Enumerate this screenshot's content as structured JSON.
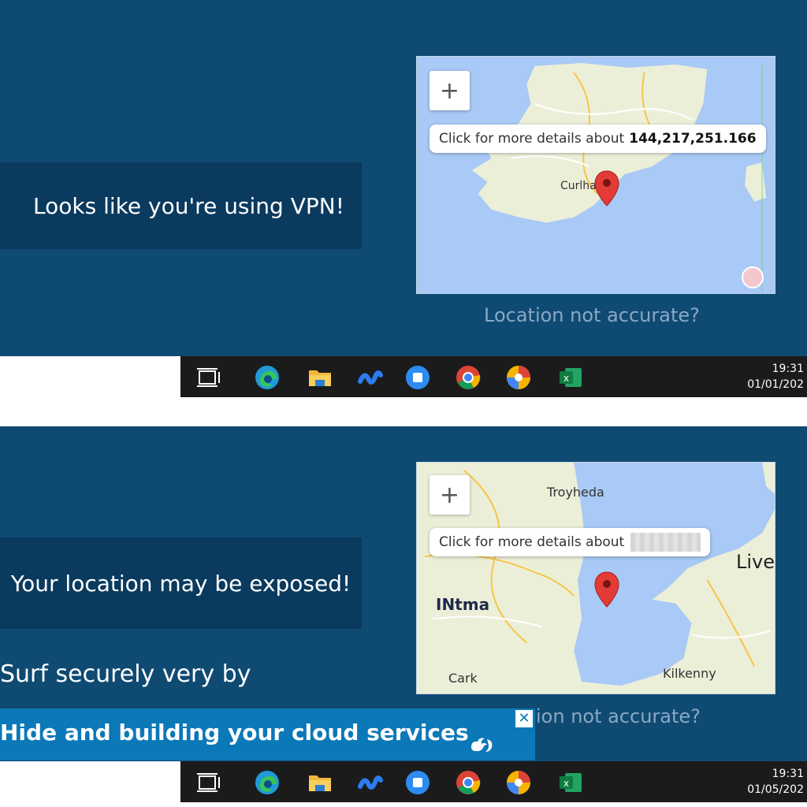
{
  "top_panel": {
    "message": "Looks like you're using VPN!",
    "map": {
      "zoom_label": "+",
      "tooltip_prefix": "Click for more details about",
      "ip_address": "144,217,251.166",
      "place_label": "Curlha"
    },
    "location_link": "Location not accurate?"
  },
  "bottom_panel": {
    "message": "Your location may be exposed!",
    "map": {
      "zoom_label": "+",
      "tooltip_prefix": "Click for more details about",
      "labels": {
        "north": "Troyheda",
        "east": "Liver",
        "brand": "INtma",
        "southwest": "Cark",
        "southeast": "Kilkenny"
      }
    },
    "location_link": "ion not accurate?",
    "surf_text": "Surf securely very by"
  },
  "banner": {
    "text": "Hide and building your cloud services",
    "close_label": "✕"
  },
  "taskbar_top": {
    "time": "19:31",
    "date": "01/01/202"
  },
  "taskbar_bottom": {
    "time": "19:31",
    "date": "01/05/202"
  },
  "icons": [
    "task-view-icon",
    "edge-icon",
    "file-explorer-icon",
    "app-wave-icon",
    "app-blue-square-icon",
    "chrome-icon",
    "chrome-alt-icon",
    "excel-icon"
  ],
  "colors": {
    "panel_bg": "#0f4a73",
    "message_bg": "#0a3a5e",
    "water": "#a9c9f6",
    "land": "#ecefd8",
    "banner_bg": "#0b78b8",
    "taskbar_bg": "#1b1b1b",
    "marker": "#e33b35"
  }
}
